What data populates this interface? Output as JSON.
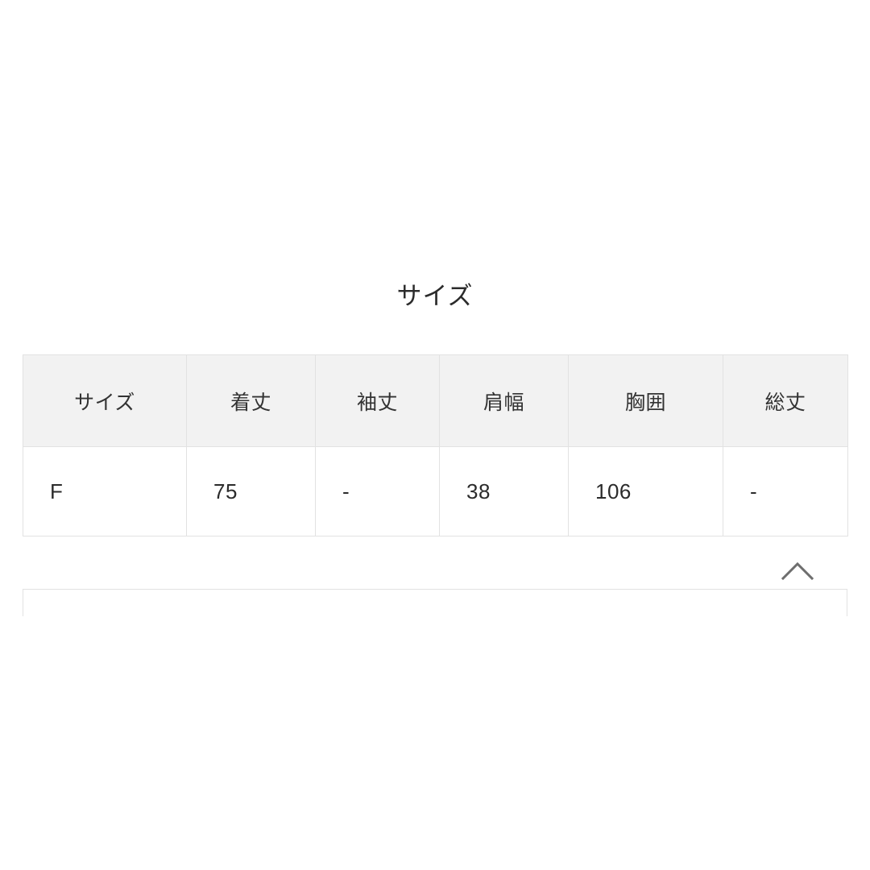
{
  "section": {
    "title": "サイズ",
    "toggle_icon": "chevron-up-icon",
    "toggle_state": "expanded"
  },
  "colors": {
    "page_background": "#ffffff",
    "header_cell_background": "#f2f2f2",
    "cell_background": "#ffffff",
    "border": "#e2e2e2",
    "text": "#333333",
    "icon": "#6e6e6e"
  },
  "size_table": {
    "columns": [
      "サイズ",
      "着丈",
      "袖丈",
      "肩幅",
      "胸囲",
      "総丈"
    ],
    "rows": [
      {
        "size": "F",
        "length": "75",
        "sleeve": "-",
        "shoulder": "38",
        "bust": "106",
        "total_length": "-"
      }
    ]
  },
  "next_panel": {
    "clipped_text": "‥"
  }
}
